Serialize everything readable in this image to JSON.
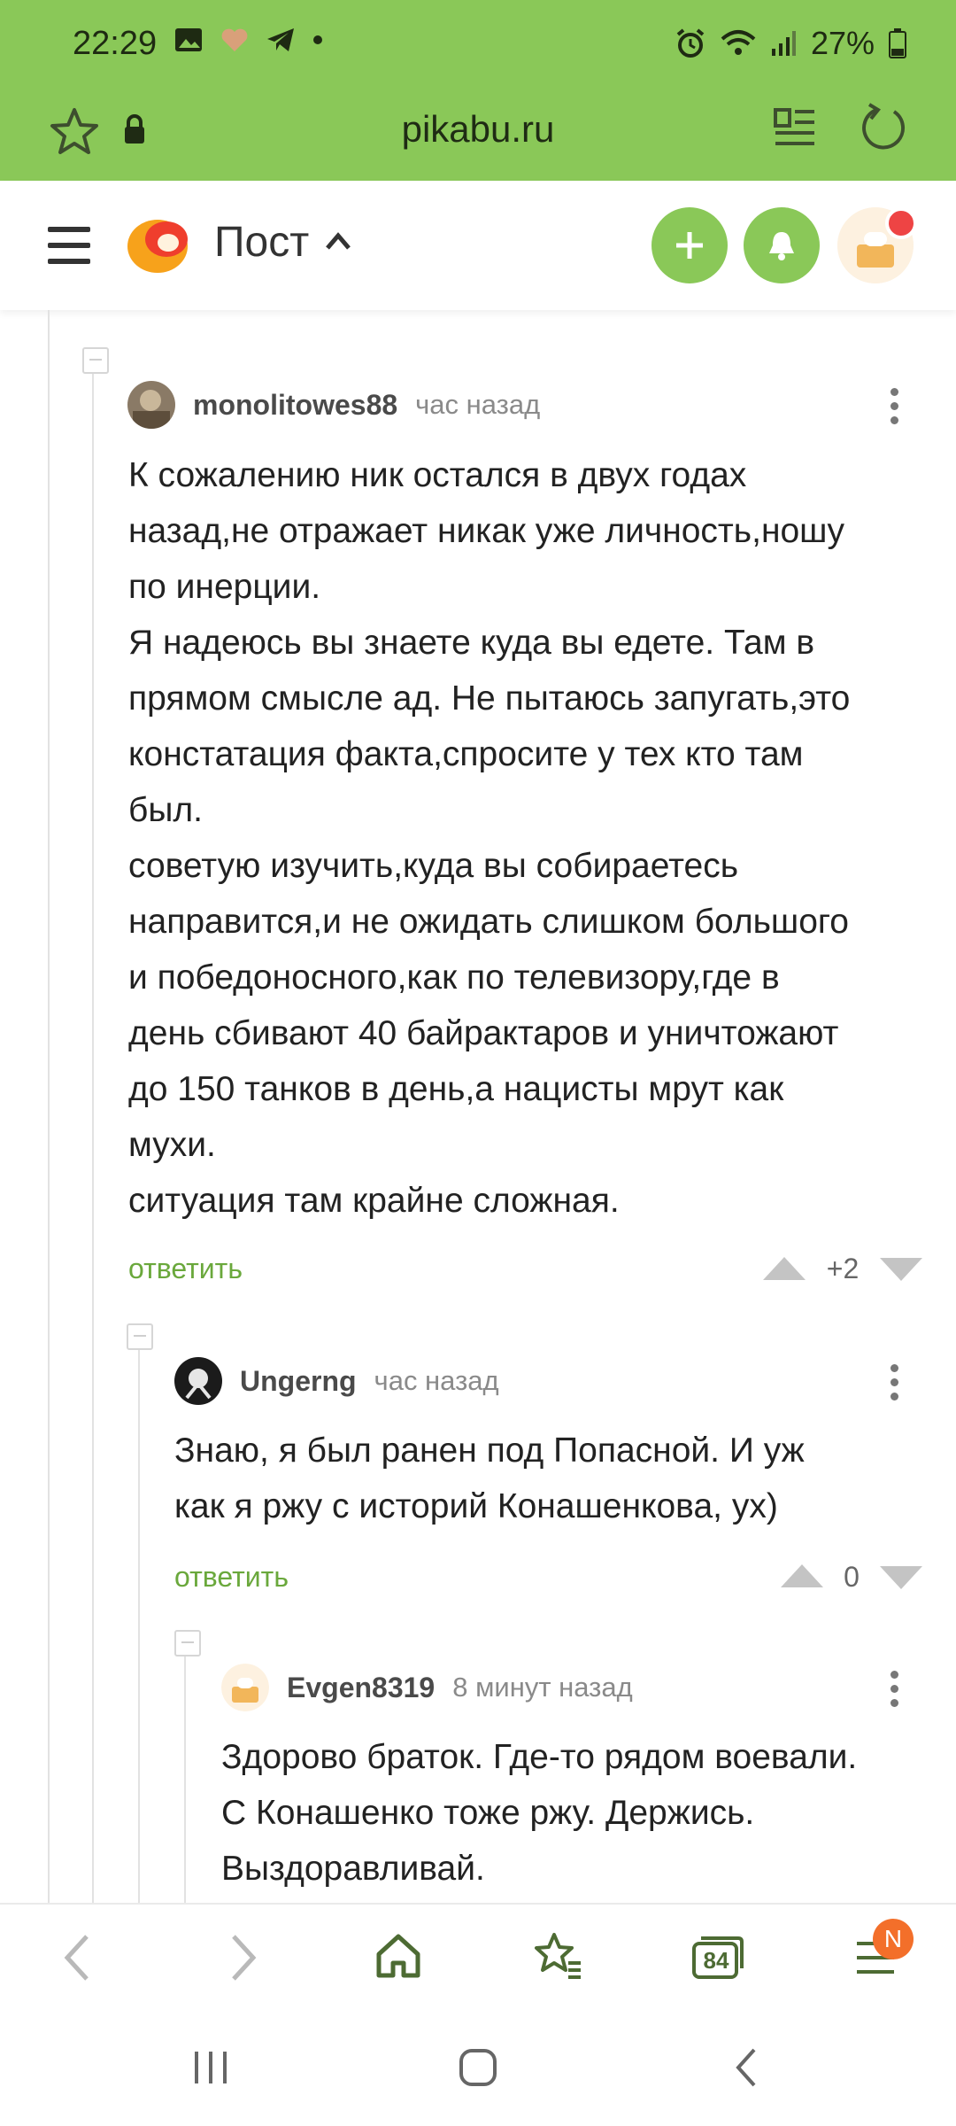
{
  "status_bar": {
    "time": "22:29",
    "battery": "27%",
    "icons_left": [
      "gallery-icon",
      "heart-icon",
      "telegram-icon",
      "dot-icon"
    ],
    "icons_right": [
      "alarm-icon",
      "wifi-icon",
      "signal-icon",
      "battery-icon"
    ]
  },
  "browser": {
    "url": "pikabu.ru"
  },
  "header": {
    "title": "Пост"
  },
  "comments": [
    {
      "user": "monolitowes88",
      "time": "час назад",
      "text": "К сожалению ник остался в двух годах\nназад,не отражает никак уже личность,ношу\nпо инерции.\nЯ надеюсь вы знаете куда вы едете. Там в\nпрямом смысле ад. Не пытаюсь запугать,это\nконстатация факта,спросите у тех кто там\nбыл.\nсоветую изучить,куда вы собираетесь\nнаправится,и не ожидать слишком большого\nи победоносного,как по телевизору,где в\nдень сбивают 40 байрактаров и уничтожают\nдо 150 танков в день,а нацисты мрут как\nмухи.\nситуация там крайне сложная.",
      "reply": "ответить",
      "score": "+2"
    },
    {
      "user": "Ungerng",
      "time": "час назад",
      "text": "Знаю, я был ранен под Попасной. И уж\nкак я ржу с историй Конашенкова, ух)",
      "reply": "ответить",
      "score": "0"
    },
    {
      "user": "Evgen8319",
      "time": "8 минут назад",
      "text": "Здорово браток. Где-то рядом воевали.\nС Конашенко тоже ржу. Держись.\nВыздоравливай."
    }
  ],
  "bottom_nav": {
    "tabs_count": "84",
    "badge": "N"
  },
  "colors": {
    "brand_green": "#8ac858",
    "reply_green": "#6aa83c",
    "badge_orange": "#f36f2a"
  }
}
